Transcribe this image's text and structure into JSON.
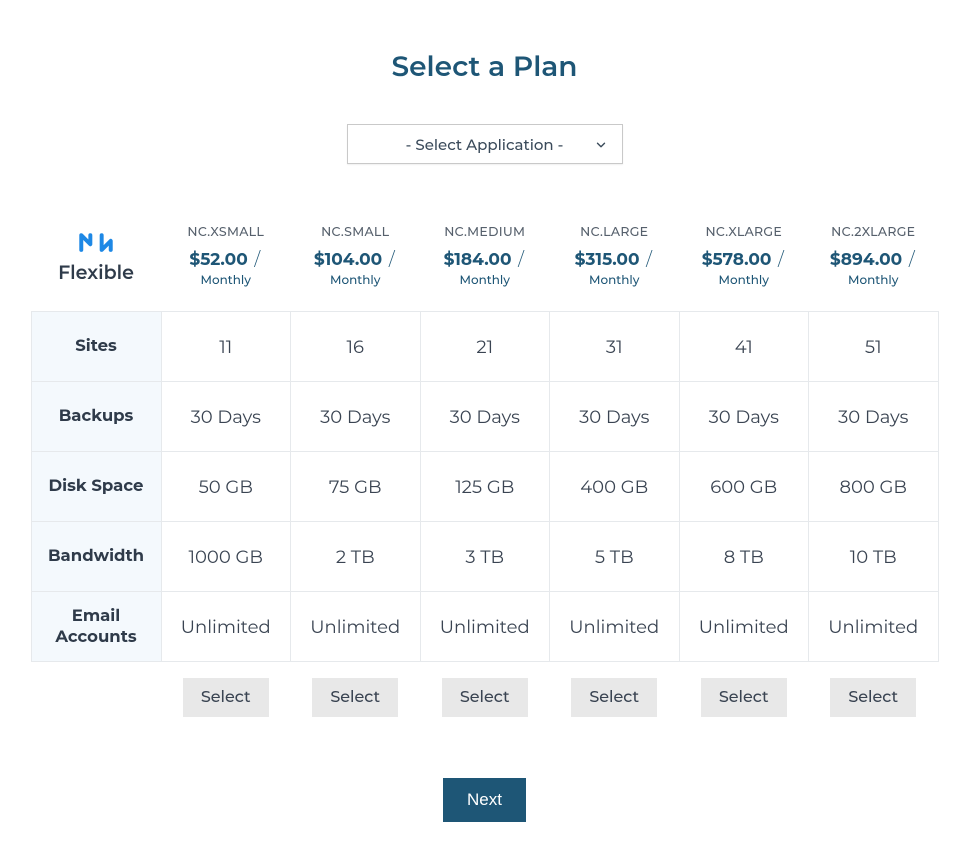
{
  "title": "Select a Plan",
  "app_select": {
    "placeholder": "- Select Application -"
  },
  "flexible_label": "Flexible",
  "period_label": "Monthly",
  "plans": [
    {
      "name": "NC.XSMALL",
      "price": "$52.00"
    },
    {
      "name": "NC.SMALL",
      "price": "$104.00"
    },
    {
      "name": "NC.MEDIUM",
      "price": "$184.00"
    },
    {
      "name": "NC.LARGE",
      "price": "$315.00"
    },
    {
      "name": "NC.XLARGE",
      "price": "$578.00"
    },
    {
      "name": "NC.2XLARGE",
      "price": "$894.00"
    }
  ],
  "rows": [
    {
      "label": "Sites",
      "values": [
        "11",
        "16",
        "21",
        "31",
        "41",
        "51"
      ]
    },
    {
      "label": "Backups",
      "values": [
        "30 Days",
        "30 Days",
        "30 Days",
        "30 Days",
        "30 Days",
        "30 Days"
      ]
    },
    {
      "label": "Disk Space",
      "values": [
        "50 GB",
        "75 GB",
        "125 GB",
        "400 GB",
        "600 GB",
        "800 GB"
      ]
    },
    {
      "label": "Bandwidth",
      "values": [
        "1000 GB",
        "2 TB",
        "3 TB",
        "5 TB",
        "8 TB",
        "10 TB"
      ]
    },
    {
      "label": "Email Accounts",
      "values": [
        "Unlimited",
        "Unlimited",
        "Unlimited",
        "Unlimited",
        "Unlimited",
        "Unlimited"
      ]
    }
  ],
  "select_label": "Select",
  "next_label": "Next"
}
